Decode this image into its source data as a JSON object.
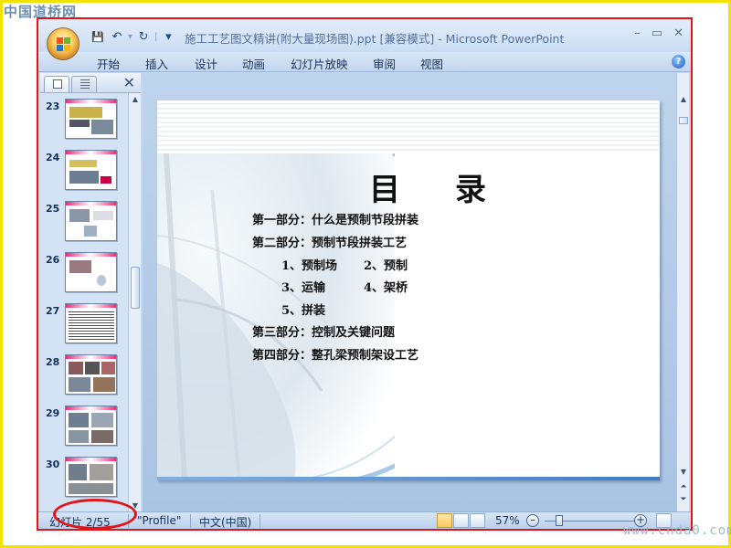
{
  "page": {
    "site_logo": "中国道桥网",
    "watermark": "www.cnda0.com"
  },
  "window": {
    "title": "施工工艺图文精讲(附大量现场图).ppt [兼容模式] - Microsoft PowerPoint",
    "controls": {
      "minimize": "–",
      "maximize": "▭",
      "close": "✕"
    }
  },
  "quick_access": {
    "save": "💾",
    "undo": "↶",
    "redo": "↻",
    "customize": "▾"
  },
  "ribbon": {
    "tabs": [
      "开始",
      "插入",
      "设计",
      "动画",
      "幻灯片放映",
      "审阅",
      "视图"
    ],
    "help": "?"
  },
  "left_panel": {
    "close": "✕",
    "thumbnails": [
      {
        "number": "23"
      },
      {
        "number": "24"
      },
      {
        "number": "25"
      },
      {
        "number": "26"
      },
      {
        "number": "27"
      },
      {
        "number": "28"
      },
      {
        "number": "29"
      },
      {
        "number": "30"
      }
    ]
  },
  "slide": {
    "title": "目录",
    "lines": [
      "第一部分：什么是预制节段拼装",
      "第二部分：预制节段拼装工艺",
      "1、预制场",
      "2、预制",
      "3、运输",
      "4、架桥",
      "5、拼装",
      "第三部分：控制及关键问题",
      "第四部分：整孔梁预制架设工艺"
    ]
  },
  "status_bar": {
    "slide_info": "幻灯片 2/55",
    "theme": "\"Profile\"",
    "language": "中文(中国)",
    "zoom": "57%",
    "zoom_level": 0.57,
    "zoom_minus": "–",
    "zoom_plus": "+"
  }
}
